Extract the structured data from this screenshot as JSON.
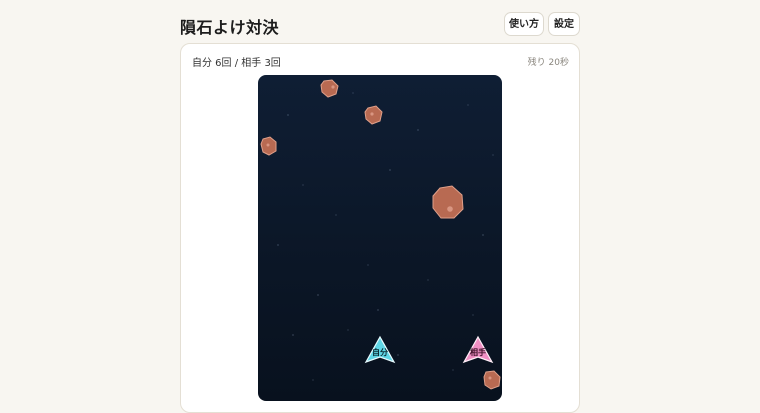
{
  "header": {
    "title": "隕石よけ対決",
    "howto_label": "使い方",
    "settings_label": "設定"
  },
  "status": {
    "score_text": "自分 6回 / 相手 3回",
    "timer_text": "残り 20秒"
  },
  "game": {
    "player": {
      "label": "自分",
      "color": "#5fd6e6"
    },
    "opponent": {
      "label": "相手",
      "color": "#f08fc4"
    },
    "meteor_color": "#b86a52",
    "field_color": "#0c1828"
  }
}
